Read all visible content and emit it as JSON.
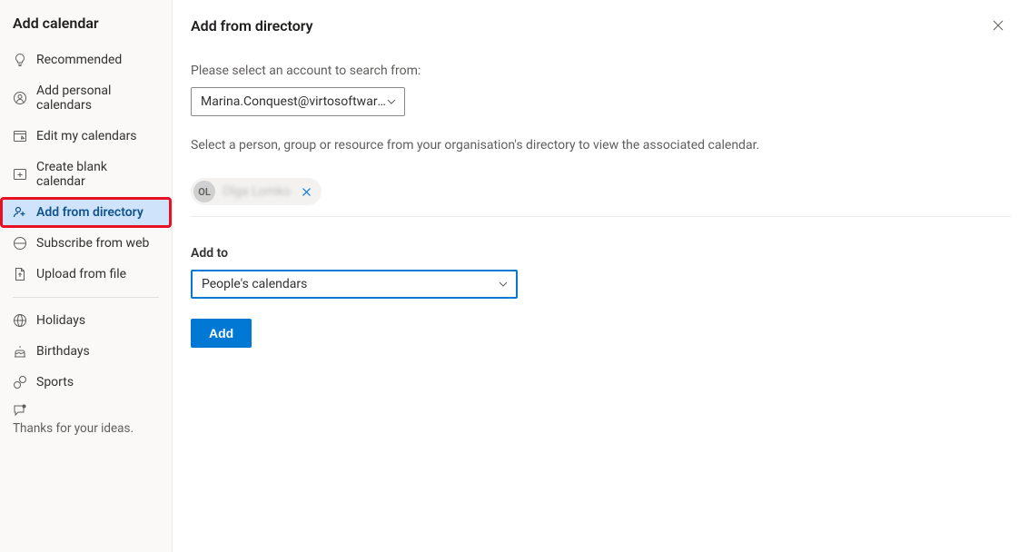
{
  "sidebar": {
    "title": "Add calendar",
    "items": [
      {
        "label": "Recommended",
        "icon": "lightbulb"
      },
      {
        "label": "Add personal calendars",
        "icon": "user-link"
      },
      {
        "label": "Edit my calendars",
        "icon": "edit-cal"
      },
      {
        "label": "Create blank calendar",
        "icon": "plus-square"
      },
      {
        "label": "Add from directory",
        "icon": "people-add",
        "active": true,
        "highlight": true
      },
      {
        "label": "Subscribe from web",
        "icon": "web"
      },
      {
        "label": "Upload from file",
        "icon": "file-up"
      }
    ],
    "items2": [
      {
        "label": "Holidays",
        "icon": "globe"
      },
      {
        "label": "Birthdays",
        "icon": "cake"
      },
      {
        "label": "Sports",
        "icon": "sports"
      }
    ],
    "footer": "Thanks for your ideas."
  },
  "main": {
    "title": "Add from directory",
    "accountLabel": "Please select an account to search from:",
    "accountSelected": "Marina.Conquest@virtosoftware.c...",
    "instruction": "Select a person, group or resource from your organisation's directory to view the associated calendar.",
    "person": {
      "initials": "OL",
      "name": "Olga Lomko"
    },
    "addToLabel": "Add to",
    "addToSelected": "People's calendars",
    "addButtonLabel": "Add"
  }
}
